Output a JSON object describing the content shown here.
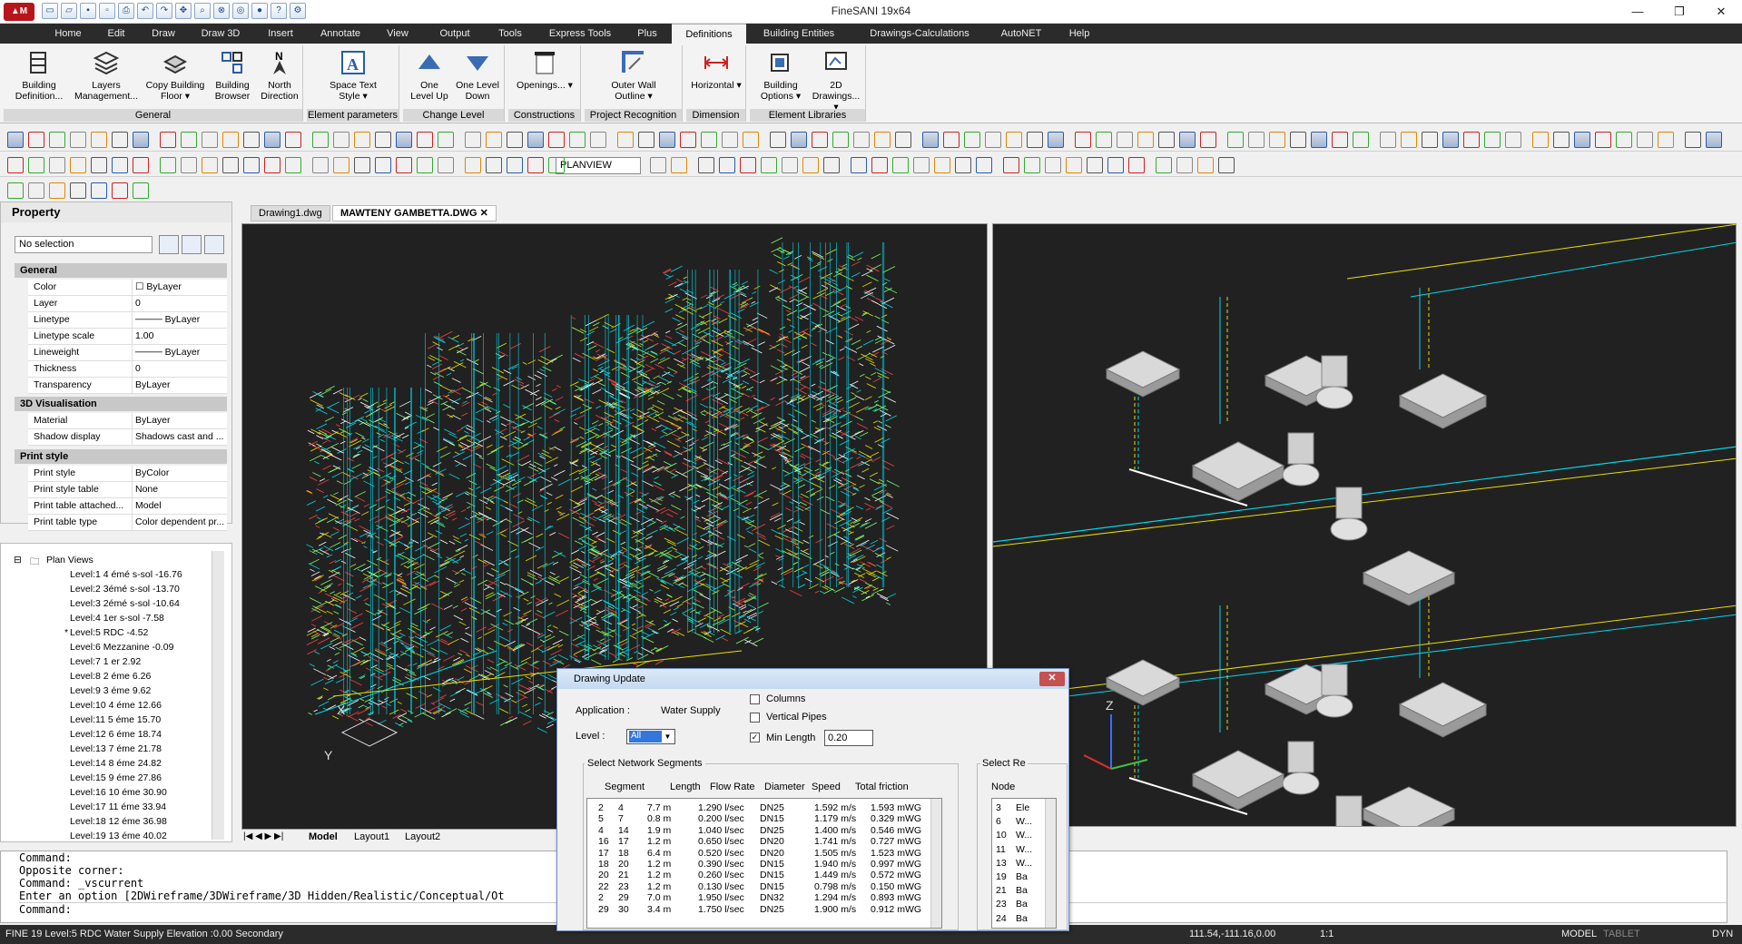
{
  "window": {
    "title": "FineSANI 19x64",
    "controls": [
      "—",
      "❐",
      "✕"
    ]
  },
  "menu": [
    {
      "label": "Home",
      "active": false
    },
    {
      "label": "Edit",
      "active": false
    },
    {
      "label": "Draw",
      "active": false
    },
    {
      "label": "Draw 3D",
      "active": false
    },
    {
      "label": "Insert",
      "active": false
    },
    {
      "label": "Annotate",
      "active": false
    },
    {
      "label": "View",
      "active": false
    },
    {
      "label": "Output",
      "active": false
    },
    {
      "label": "Tools",
      "active": false
    },
    {
      "label": "Express Tools",
      "active": false
    },
    {
      "label": "Plus",
      "active": false
    },
    {
      "label": "Definitions",
      "active": true
    },
    {
      "label": "Building Entities",
      "active": false
    },
    {
      "label": "Drawings-Calculations",
      "active": false
    },
    {
      "label": "AutoNET",
      "active": false
    },
    {
      "label": "Help",
      "active": false
    }
  ],
  "ribbon": {
    "groups": [
      {
        "title": "General",
        "buttons": [
          "Building Definition...",
          "Layers Management...",
          "Copy Building Floor ▾",
          "Building Browser",
          "North Direction"
        ]
      },
      {
        "title": "Element parameters",
        "buttons": [
          "Space Text Style ▾"
        ]
      },
      {
        "title": "Change Level",
        "buttons": [
          "One Level Up",
          "One Level Down"
        ]
      },
      {
        "title": "Constructions",
        "buttons": [
          "Openings... ▾"
        ]
      },
      {
        "title": "Project Recognition",
        "buttons": [
          "Outer Wall Outline ▾"
        ]
      },
      {
        "title": "Dimension",
        "buttons": [
          "Horizontal ▾"
        ]
      },
      {
        "title": "Element Libraries",
        "buttons": [
          "Building Options ▾",
          "2D Drawings... ▾"
        ]
      }
    ]
  },
  "toolbar": {
    "view_select": "PLANVIEW"
  },
  "property": {
    "title": "Property",
    "selection": "No selection",
    "sections": [
      {
        "name": "General",
        "rows": [
          [
            "Color",
            "☐ ByLayer"
          ],
          [
            "Layer",
            "0"
          ],
          [
            "Linetype",
            "──── ByLayer"
          ],
          [
            "Linetype scale",
            "1.00"
          ],
          [
            "Lineweight",
            "──── ByLayer"
          ],
          [
            "Thickness",
            "0"
          ],
          [
            "Transparency",
            "ByLayer"
          ]
        ]
      },
      {
        "name": "3D Visualisation",
        "rows": [
          [
            "Material",
            "ByLayer"
          ],
          [
            "Shadow display",
            "Shadows cast and ..."
          ]
        ]
      },
      {
        "name": "Print style",
        "rows": [
          [
            "Print style",
            "ByColor"
          ],
          [
            "Print style table",
            "None"
          ],
          [
            "Print table attached...",
            "Model"
          ],
          [
            "Print table type",
            "Color dependent pr..."
          ]
        ]
      }
    ]
  },
  "tree": {
    "root": "Plan Views",
    "items": [
      "Level:1 4 émé s-sol -16.76",
      "Level:2 3émé s-sol -13.70",
      "Level:3 2émé s-sol -10.64",
      "Level:4 1er s-sol -7.58",
      "Level:5 RDC -4.52",
      "Level:6 Mezzanine -0.09",
      "Level:7 1 er 2.92",
      "Level:8 2 éme 6.26",
      "Level:9 3 éme 9.62",
      "Level:10 4 éme 12.66",
      "Level:11 5 éme 15.70",
      "Level:12 6 éme 18.74",
      "Level:13 7 éme 21.78",
      "Level:14 8 éme 24.82",
      "Level:15 9 éme 27.86",
      "Level:16 10 éme 30.90",
      "Level:17 11 éme 33.94",
      "Level:18 12 éme 36.98",
      "Level:19 13 éme 40.02"
    ],
    "active_index": 4
  },
  "doc_tabs": [
    {
      "label": "Drawing1.dwg",
      "active": false
    },
    {
      "label": "MAWTENY GAMBETTA.DWG ✕",
      "active": true
    }
  ],
  "layout_tabs": [
    "Model",
    "Layout1",
    "Layout2"
  ],
  "dialog": {
    "title": "Drawing Update",
    "application_label": "Application :",
    "application_value": "Water Supply",
    "level_label": "Level :",
    "level_value": "All",
    "columns_label": "Columns",
    "vertical_pipes_label": "Vertical Pipes",
    "min_length_label": "Min Length",
    "min_length_value": "0.20",
    "segments_title": "Select Network Segments",
    "select_title": "Select Re",
    "headers": [
      "Segment",
      "Length",
      "Flow Rate",
      "Diameter",
      "Speed",
      "Total friction"
    ],
    "rows": [
      [
        "2",
        "4",
        "7.7 m",
        "1.290 l/sec",
        "DN25",
        "1.592 m/s",
        "1.593 mWG"
      ],
      [
        "5",
        "7",
        "0.8 m",
        "0.200 l/sec",
        "DN15",
        "1.179 m/s",
        "0.329 mWG"
      ],
      [
        "4",
        "14",
        "1.9 m",
        "1.040 l/sec",
        "DN25",
        "1.400 m/s",
        "0.546 mWG"
      ],
      [
        "16",
        "17",
        "1.2 m",
        "0.650 l/sec",
        "DN20",
        "1.741 m/s",
        "0.727 mWG"
      ],
      [
        "17",
        "18",
        "6.4 m",
        "0.520 l/sec",
        "DN20",
        "1.505 m/s",
        "1.523 mWG"
      ],
      [
        "18",
        "20",
        "1.2 m",
        "0.390 l/sec",
        "DN15",
        "1.940 m/s",
        "0.997 mWG"
      ],
      [
        "20",
        "21",
        "1.2 m",
        "0.260 l/sec",
        "DN15",
        "1.449 m/s",
        "0.572 mWG"
      ],
      [
        "22",
        "23",
        "1.2 m",
        "0.130 l/sec",
        "DN15",
        "0.798 m/s",
        "0.150 mWG"
      ],
      [
        "2",
        "29",
        "7.0 m",
        "1.950 l/sec",
        "DN32",
        "1.294 m/s",
        "0.893 mWG"
      ],
      [
        "29",
        "30",
        "3.4 m",
        "1.750 l/sec",
        "DN25",
        "1.900 m/s",
        "0.912 mWG"
      ]
    ],
    "node_header": "Node",
    "nodes": [
      [
        "3",
        "Ele"
      ],
      [
        "6",
        "W..."
      ],
      [
        "10",
        "W..."
      ],
      [
        "11",
        "W..."
      ],
      [
        "13",
        "W..."
      ],
      [
        "19",
        "Ba"
      ],
      [
        "21",
        "Ba"
      ],
      [
        "23",
        "Ba"
      ],
      [
        "24",
        "Ba"
      ]
    ]
  },
  "command": {
    "lines": [
      "Command:",
      "Opposite corner:",
      "Command: _vscurrent",
      "Enter an option [2DWireframe/3DWireframe/3D Hidden/Realistic/Conceptual/Ot"
    ],
    "prompt": "Command:"
  },
  "status": {
    "left": "FINE 19 Level:5 RDC Water Supply Elevation :0.00 Secondary",
    "coords": "111.54,-111.16,0.00",
    "scale": "1:1",
    "model": "MODEL",
    "tablet": "TABLET",
    "dyn": "DYN"
  },
  "colors": {
    "accent": "#b8141c",
    "viewport_bg": "#212121",
    "pipe_cyan": "#00d8e8",
    "pipe_yellow": "#e8e000",
    "pipe_green": "#7cff6a"
  }
}
